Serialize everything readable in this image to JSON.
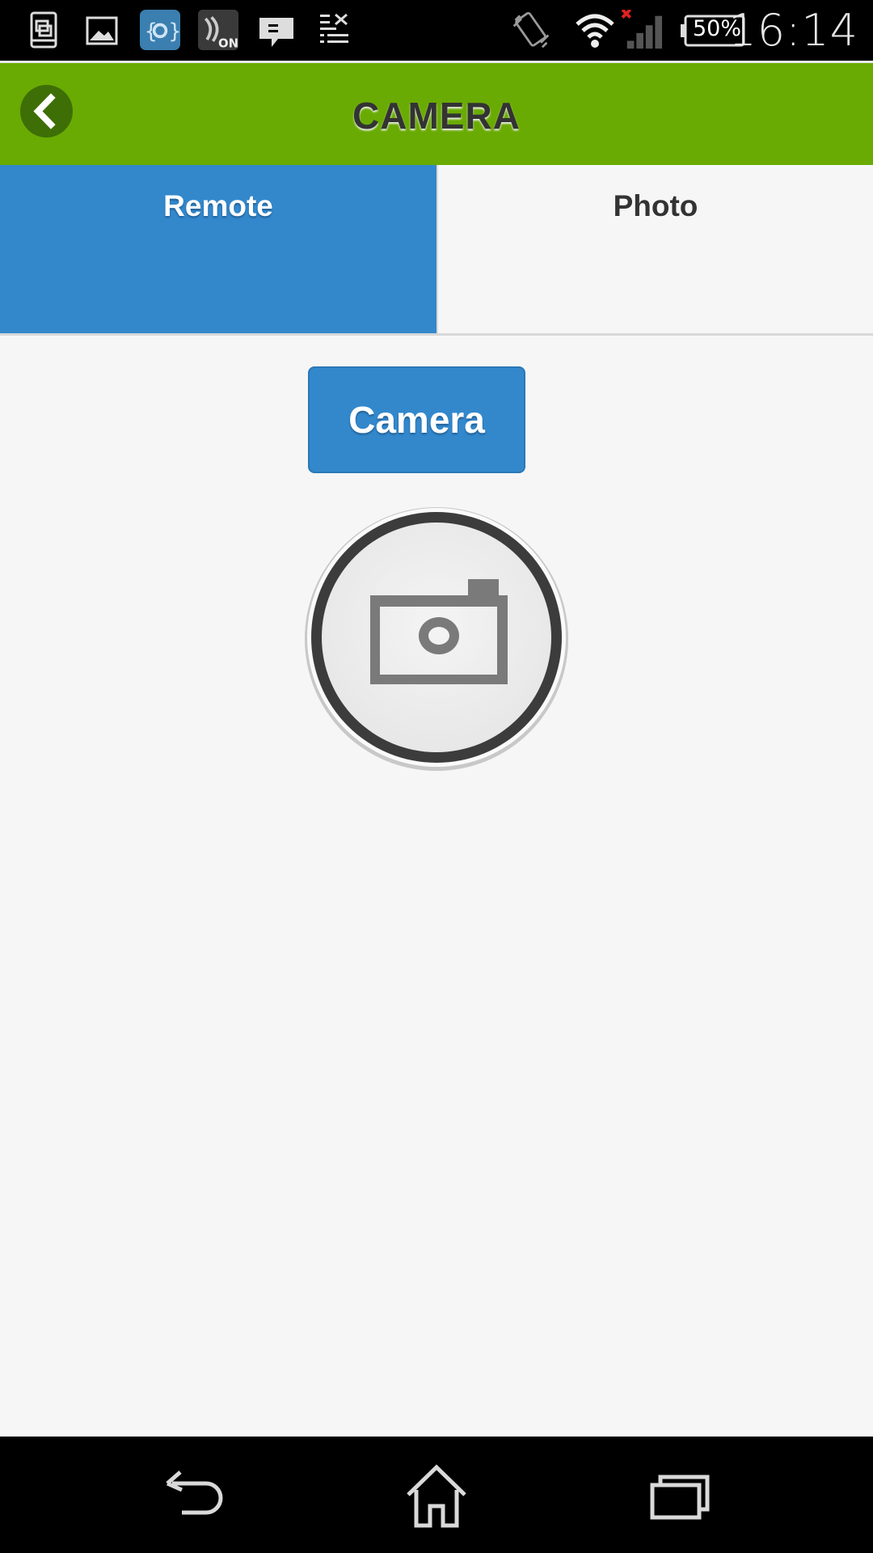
{
  "status_bar": {
    "time": "16:14",
    "battery_percent": "50%",
    "notification_icons": [
      "screenshot-icon",
      "gallery-icon",
      "settings-app-icon",
      "nfc-on-icon",
      "message-icon",
      "download-list-icon"
    ],
    "system_icons": [
      "vibrate-icon",
      "wifi-icon",
      "signal-no-service-icon",
      "battery-icon"
    ]
  },
  "app_bar": {
    "title": "CAMERA",
    "back_icon": "chevron-left-icon",
    "color": "#69ab02"
  },
  "tabs": [
    {
      "label": "Remote",
      "selected": true
    },
    {
      "label": "Photo",
      "selected": false
    }
  ],
  "main": {
    "camera_button_label": "Camera",
    "shutter_icon": "camera-icon",
    "accent_color": "#3388cc"
  },
  "nav_bar": {
    "icons": [
      "back-nav-icon",
      "home-nav-icon",
      "recent-apps-icon"
    ]
  }
}
